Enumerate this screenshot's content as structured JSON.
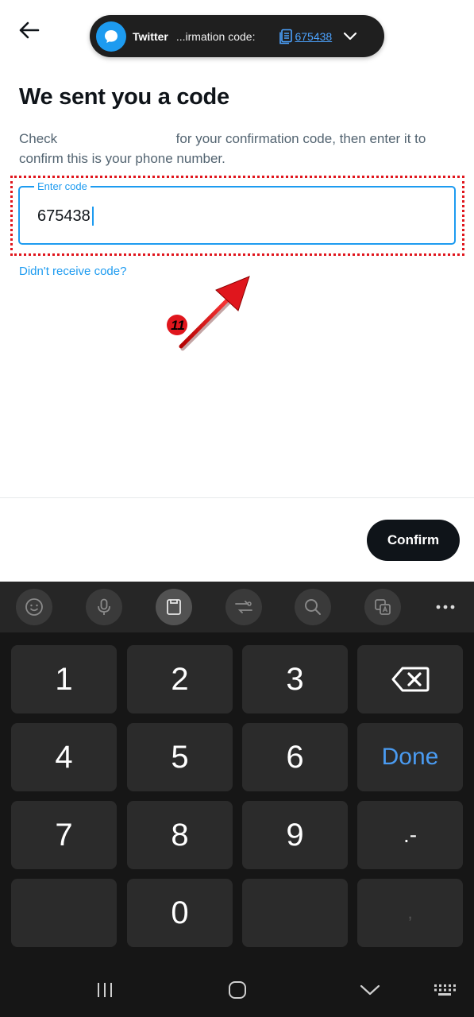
{
  "notification": {
    "app_name": "Twitter",
    "message": "...irmation code:",
    "code": "675438",
    "app_icon": "chat-bubble-icon",
    "expand_icon": "chevron-down-icon"
  },
  "page": {
    "back_icon": "arrow-left-icon",
    "title": "We sent you a code",
    "description_start": "Check",
    "description_end": "for your confirmation code, then enter it to confirm this is your phone number.",
    "code_field": {
      "label": "Enter code",
      "value": "675438"
    },
    "resend_link": "Didn't receive code?",
    "annotation_marker": "11",
    "confirm_button": "Confirm"
  },
  "keyboard": {
    "toolbar": [
      "emoji-icon",
      "microphone-icon",
      "clipboard-icon",
      "mode-switch-icon",
      "search-icon",
      "translate-icon",
      "more-icon"
    ],
    "keys": [
      "1",
      "2",
      "3",
      "4",
      "5",
      "6",
      "Done",
      "7",
      "8",
      "9",
      ".-",
      "0",
      ","
    ]
  },
  "nav": [
    "recent-apps-icon",
    "home-icon",
    "hide-keyboard-icon",
    "keyboard-icon"
  ],
  "colors": {
    "accent": "#1d9bf0",
    "annotation": "#e0161d",
    "dark": "#0f1419",
    "keyboard_bg": "#161616",
    "key_bg": "#2b2b2b",
    "done_key": "#4a9bf1"
  }
}
